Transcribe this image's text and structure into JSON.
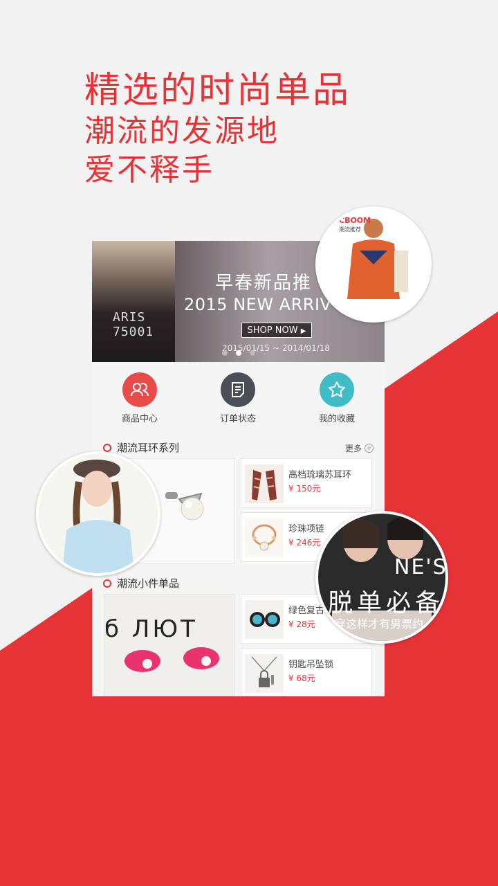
{
  "headline": {
    "line1": "精选的时尚单品",
    "line2": "潮流的发源地",
    "line3": "爱不释手"
  },
  "banner": {
    "title": "早春新品推",
    "subtitle": "2015 NEW ARRIV",
    "button": "SHOP NOW",
    "dates": "2015/01/15 ~ 2014/01/18",
    "model_text": "ARIS\n75001",
    "slide_index": 1,
    "slide_count": 3
  },
  "nav": {
    "items": [
      {
        "label": "商品中心",
        "icon": "users-icon",
        "color": "#e94b4b"
      },
      {
        "label": "订单状态",
        "icon": "document-icon",
        "color": "#4a4f57"
      },
      {
        "label": "我的收藏",
        "icon": "star-icon",
        "color": "#3fbcc5"
      }
    ]
  },
  "section1": {
    "title": "潮流耳环系列",
    "more": "更多",
    "items": [
      {
        "name": "高档琉璃苏耳环",
        "price": "¥ 150元"
      },
      {
        "name": "珍珠项链",
        "price": "¥ 246元"
      }
    ]
  },
  "section2": {
    "title": "潮流小件单品",
    "big_text": "б ЛЮТ",
    "items": [
      {
        "name": "绿色复古",
        "price": "¥ 28元"
      },
      {
        "name": "钥匙吊坠锁",
        "price": "¥ 68元"
      }
    ]
  },
  "bubbles": {
    "top_right_brand": "CBOOM",
    "top_right_tag": "潮流推荐",
    "bottom_right_big": "脱单必备",
    "bottom_right_small": "穿这样才有男票约",
    "bottom_right_brand": "NE'S"
  },
  "colors": {
    "accent": "#e63336",
    "background": "#f2f2f2"
  }
}
